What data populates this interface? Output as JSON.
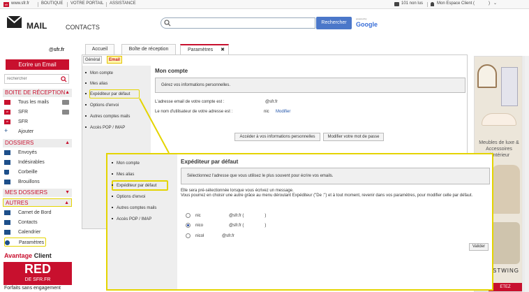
{
  "topbar": {
    "site": "www.sfr.fr",
    "links": [
      "BOUTIQUE",
      "VOTRE PORTAIL",
      "ASSISTANCE"
    ],
    "unread": "101 non lus",
    "espace": "Mon Espace Client (",
    "espace_end": ")"
  },
  "header": {
    "mail": "MAIL",
    "contacts": "CONTACTS",
    "search_button": "Rechercher",
    "google_small": "powered by",
    "google": "Google"
  },
  "tabs": [
    "Accueil",
    "Boîte de réception",
    "Paramètres"
  ],
  "tab_close": "✖",
  "user": "@sfr.fr",
  "sidebar": {
    "compose": "Ecrire un Email",
    "search_placeholder": "rechercher",
    "sections": {
      "inbox": "BOITE DE RÉCEPTION",
      "folders": "DOSSIERS",
      "myfolders": "MES DOSSIERS",
      "others": "AUTRES"
    },
    "inbox_items": [
      "Tous les mails",
      "SFR",
      "SFR",
      "Ajouter"
    ],
    "folder_items": [
      "Envoyés",
      "Indésirables",
      "Corbeille",
      "Brouillons"
    ],
    "other_items": [
      "Carnet de Bord",
      "Contacts",
      "Calendrier",
      "Paramètres"
    ],
    "advantage": "Avantage",
    "advantage_client": "Client",
    "red": "RED",
    "red_sfr": "DE SFR.FR",
    "forfait": "Forfaits sans engagement"
  },
  "settings": {
    "subtabs": [
      "Général",
      "Email"
    ],
    "nav": [
      "Mon compte",
      "Mes alias",
      "Expéditeur par défaut",
      "Options d'envoi",
      "Autres comptes mails",
      "Accès POP / IMAP"
    ],
    "title": "Mon compte",
    "box": "Gérez vos informations personnelles.",
    "address_label": "L'adresse email de votre compte est :",
    "address_value": "@sfr.fr",
    "username_label": "Le nom d'utilisateur de votre adresse est :",
    "username_value": "nic",
    "modify": "Modifier",
    "btn_info": "Accéder à vos informations personnelles",
    "btn_pwd": "Modifier votre mot de passe"
  },
  "ad": {
    "text": "Meubles de luxe & Accessoires d'intérieur",
    "brand": "STWING",
    "cta": "ETEZ"
  },
  "zoom": {
    "nav": [
      "Mon compte",
      "Mes alias",
      "Expéditeur par défaut",
      "Options d'envoi",
      "Autres comptes mails",
      "Accès POP / IMAP"
    ],
    "title": "Expéditeur par défaut",
    "box": "Sélectionnez l'adresse que vous utilisez le plus souvent pour écrire vos emails.",
    "desc1": "Elle sera pré-sélectionnée lorsque vous écrivez un message.",
    "desc2": "Vous pourrez en choisir une autre grâce au menu déroulant Expéditeur (\"De :\") et à tout moment, revenir dans vos paramètres, pour modifier celle par défaut.",
    "options": [
      {
        "name": "nic",
        "addr": "@sfr.fr (                  )",
        "checked": false
      },
      {
        "name": "nico",
        "addr": "@sfr.fr (                  )",
        "checked": true
      },
      {
        "name": "nicol",
        "addr": "@sfr.fr",
        "checked": false
      }
    ],
    "validate": "Valider"
  },
  "colors": {
    "brand_red": "#c8102e",
    "highlight": "#e4d400",
    "search_blue": "#4b77c9"
  }
}
